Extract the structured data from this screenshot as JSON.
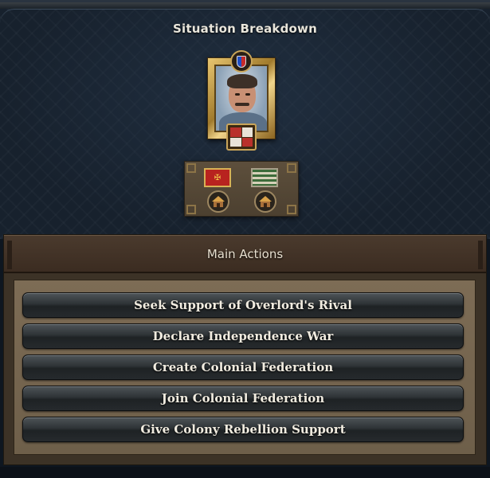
{
  "window": {
    "title": "Situation Breakdown"
  },
  "portrait": {
    "emblem_icon": "national-shield-icon",
    "coat_of_arms_icon": "coat-of-arms-icon"
  },
  "slots": {
    "left_flag_icon": "red-flag-icon",
    "right_flag_icon": "striped-flag-icon",
    "building_icon": "hut-icon"
  },
  "main_actions": {
    "header": "Main Actions",
    "buttons": [
      "Seek Support of Overlord's Rival",
      "Declare Independence War",
      "Create Colonial Federation",
      "Join Colonial Federation",
      "Give Colony Rebellion Support"
    ]
  },
  "colors": {
    "gold_frame": "#c9a55a",
    "panel_brown": "#3c3226",
    "background_navy": "#17212d"
  }
}
